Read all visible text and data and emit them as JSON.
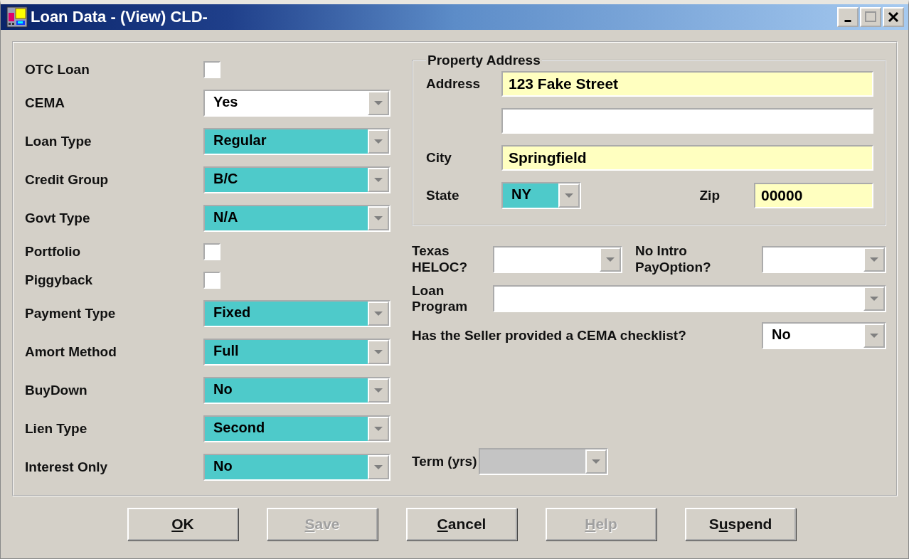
{
  "window": {
    "title": "Loan Data - (View) CLD-"
  },
  "left_fields": [
    {
      "label": "OTC Loan",
      "kind": "checkbox",
      "checked": false
    },
    {
      "label": "CEMA",
      "kind": "combo",
      "value": "Yes",
      "color": "#ffffff"
    },
    {
      "label": "Loan Type",
      "kind": "combo",
      "value": "Regular",
      "color": "#4ecaca"
    },
    {
      "label": "Credit Group",
      "kind": "combo",
      "value": "B/C",
      "color": "#4ecaca"
    },
    {
      "label": "Govt Type",
      "kind": "combo",
      "value": "N/A",
      "color": "#4ecaca"
    },
    {
      "label": "Portfolio",
      "kind": "checkbox",
      "checked": false
    },
    {
      "label": "Piggyback",
      "kind": "checkbox",
      "checked": false
    },
    {
      "label": "Payment Type",
      "kind": "combo",
      "value": "Fixed",
      "color": "#4ecaca"
    },
    {
      "label": "Amort Method",
      "kind": "combo",
      "value": "Full",
      "color": "#4ecaca"
    },
    {
      "label": "BuyDown",
      "kind": "combo",
      "value": "No",
      "color": "#4ecaca"
    },
    {
      "label": "Lien Type",
      "kind": "combo",
      "value": "Second",
      "color": "#4ecaca"
    },
    {
      "label": "Interest Only",
      "kind": "combo",
      "value": "No",
      "color": "#4ecaca"
    }
  ],
  "property_address": {
    "title": "Property Address",
    "address_label": "Address",
    "address_line_1": {
      "value": "123 Fake Street",
      "color": "#ffffc0"
    },
    "address_line_2": {
      "color": "#ffffff"
    },
    "city_label": "City",
    "city": {
      "value": "Springfield",
      "color": "#ffffc0"
    },
    "state_label": "State",
    "state": {
      "value": "NY",
      "color": "#4ecaca"
    },
    "zip_label": "Zip",
    "zip": {
      "value": "00000",
      "color": "#ffffc0"
    }
  },
  "texas_heloc": {
    "label": "Texas HELOC?",
    "color": "#ffffff"
  },
  "no_intro_pay_option": {
    "label": "No Intro PayOption?",
    "color": "#ffffff"
  },
  "loan_program": {
    "label": "Loan Program",
    "color": "#ffffff"
  },
  "cema_checklist": {
    "label": "Has the Seller provided a CEMA checklist?",
    "value": "No",
    "color": "#ffffff"
  },
  "term": {
    "label": "Term (yrs)",
    "color": "#c4c4c4"
  },
  "buttons": [
    {
      "label_parts": [
        {
          "text": "O",
          "underlined": true
        },
        {
          "text": "K",
          "underlined": false
        }
      ],
      "disabled": false
    },
    {
      "label_parts": [
        {
          "text": "S",
          "underlined": true
        },
        {
          "text": "ave",
          "underlined": false
        }
      ],
      "disabled": true
    },
    {
      "label_parts": [
        {
          "text": "C",
          "underlined": true
        },
        {
          "text": "ancel",
          "underlined": false
        }
      ],
      "disabled": false
    },
    {
      "label_parts": [
        {
          "text": "H",
          "underlined": true
        },
        {
          "text": "elp",
          "underlined": false
        }
      ],
      "disabled": true
    },
    {
      "label_parts": [
        {
          "text": "S",
          "underlined": false
        },
        {
          "text": "u",
          "underlined": true
        },
        {
          "text": "spend",
          "underlined": false
        }
      ],
      "disabled": false
    }
  ]
}
